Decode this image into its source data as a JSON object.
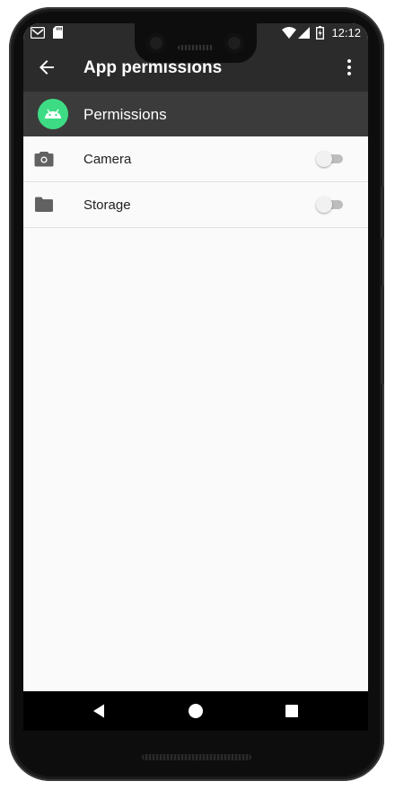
{
  "status_bar": {
    "time": "12:12",
    "icons": [
      "gmail-notification-icon",
      "sd-card-icon",
      "wifi-icon",
      "cell-signal-icon",
      "battery-charging-icon"
    ]
  },
  "app_bar": {
    "title": "App permissions",
    "back_icon": "arrow-back-icon",
    "menu_icon": "more-vert-icon"
  },
  "header": {
    "label": "Permissions",
    "app_icon": "android-icon",
    "app_icon_color": "#3ddc84"
  },
  "permissions": [
    {
      "label": "Camera",
      "icon": "camera-icon",
      "enabled": false
    },
    {
      "label": "Storage",
      "icon": "folder-icon",
      "enabled": false
    }
  ],
  "nav_bar": {
    "buttons": [
      "back-triangle-icon",
      "home-circle-icon",
      "recents-square-icon"
    ]
  },
  "colors": {
    "app_bar": "#2b2b2b",
    "header": "#3b3b3b",
    "background": "#fafafa",
    "switch_off_track": "#bdbdbd",
    "switch_off_thumb": "#f1f1f1"
  }
}
